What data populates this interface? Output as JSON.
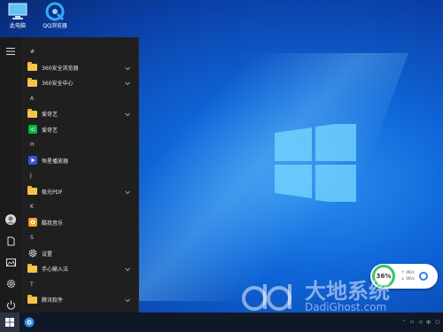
{
  "desktop": {
    "icons": [
      {
        "label": "此电脑",
        "icon": "computer-icon"
      },
      {
        "label": "QQ浏览器",
        "icon": "qq-browser-icon"
      }
    ]
  },
  "start_menu": {
    "items": [
      {
        "kind": "letter",
        "label": "#"
      },
      {
        "kind": "folder",
        "label": "360安全浏览器",
        "expandable": true
      },
      {
        "kind": "folder",
        "label": "360安全中心",
        "expandable": true
      },
      {
        "kind": "letter",
        "label": "A"
      },
      {
        "kind": "folder",
        "label": "爱奇艺",
        "expandable": true
      },
      {
        "kind": "app",
        "label": "爱奇艺",
        "icon": "iqiyi-icon",
        "color": "#00b83a"
      },
      {
        "kind": "letter",
        "label": "H"
      },
      {
        "kind": "app",
        "label": "恒星播放器",
        "icon": "player-icon",
        "color": "#3b4fd8"
      },
      {
        "kind": "letter",
        "label": "J"
      },
      {
        "kind": "folder",
        "label": "极光PDF",
        "expandable": true
      },
      {
        "kind": "letter",
        "label": "K"
      },
      {
        "kind": "app",
        "label": "酷我音乐",
        "icon": "kuwo-music-icon",
        "color": "#f2a01c"
      },
      {
        "kind": "letter",
        "label": "S"
      },
      {
        "kind": "app",
        "label": "设置",
        "icon": "gear-icon",
        "color": "#cfcfcf"
      },
      {
        "kind": "folder",
        "label": "手心输入法",
        "expandable": true
      },
      {
        "kind": "letter",
        "label": "T"
      },
      {
        "kind": "folder",
        "label": "腾讯软件",
        "expandable": true
      }
    ]
  },
  "netwidget": {
    "percent": "36%",
    "up": "0K/s",
    "down": "0K/s"
  },
  "watermark": {
    "main": "大地系统",
    "sub": "DadiGhost.com"
  },
  "colors": {
    "accent_green": "#3ec16b",
    "folder": "#f3c54a"
  }
}
